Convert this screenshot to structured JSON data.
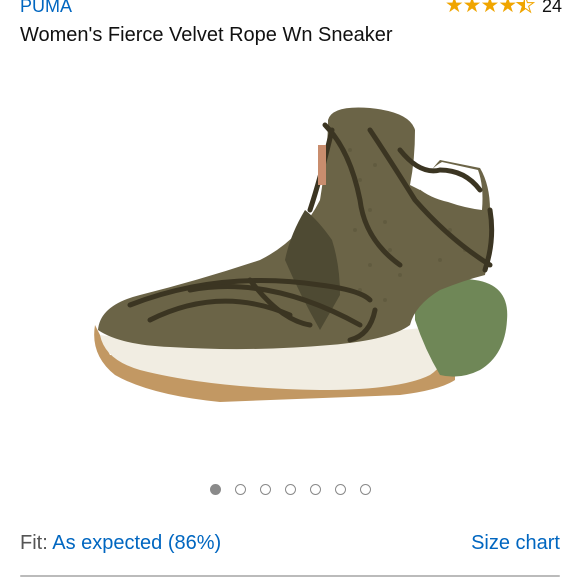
{
  "product": {
    "brand": "PUMA",
    "title": "Women's Fierce Velvet Rope Wn Sneaker",
    "rating_value": 4.5,
    "rating_count": "24",
    "star_color": "#f0a500",
    "image_icon": "sneaker-image",
    "image_count": 7,
    "active_image_index": 0
  },
  "fit": {
    "label": "Fit:",
    "value": "As expected (86%)",
    "size_chart_label": "Size chart"
  },
  "colors": {
    "link": "#0066c0",
    "sneaker_upper": "#6b6447",
    "sneaker_heel": "#6f8757",
    "sole": "#f1ede2",
    "gum": "#c29863"
  }
}
